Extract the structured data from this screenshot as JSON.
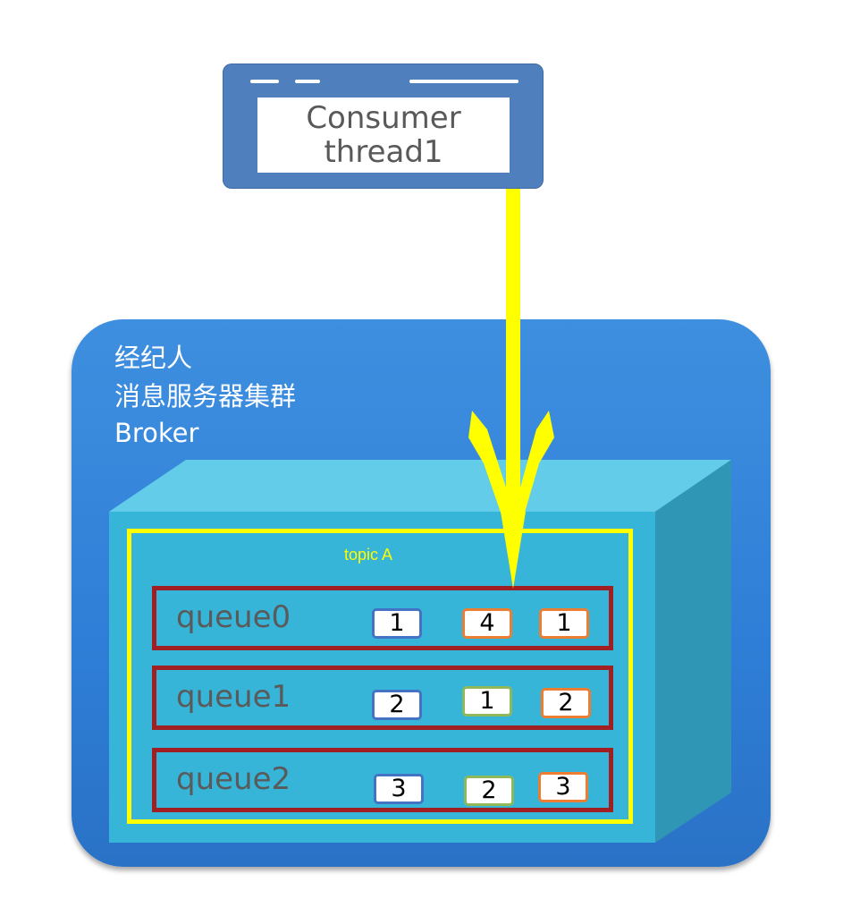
{
  "consumer": {
    "line1": "Consumer",
    "line2": "thread1"
  },
  "broker": {
    "line1": "经纪人",
    "line2": "消息服务器集群",
    "line3": "Broker"
  },
  "topic": {
    "label": "topic  A"
  },
  "queues": [
    {
      "label": "queue0",
      "messages": [
        {
          "value": "1",
          "color": "blue"
        },
        {
          "value": "4",
          "color": "orange"
        },
        {
          "value": "1",
          "color": "orange"
        }
      ]
    },
    {
      "label": "queue1",
      "messages": [
        {
          "value": "2",
          "color": "blue"
        },
        {
          "value": "1",
          "color": "green"
        },
        {
          "value": "2",
          "color": "orange"
        }
      ]
    },
    {
      "label": "queue2",
      "messages": [
        {
          "value": "3",
          "color": "blue"
        },
        {
          "value": "2",
          "color": "green"
        },
        {
          "value": "3",
          "color": "orange"
        }
      ]
    }
  ],
  "colors": {
    "arrow": "#ffff00",
    "queue_border": "#9f1f22",
    "topic_border": "#ffff00",
    "broker_fill": "#2e7ed7",
    "consumer_fill": "#4f7fbd",
    "msg_blue": "#4472c4",
    "msg_orange": "#ed7d31",
    "msg_green": "#8fb85a"
  }
}
